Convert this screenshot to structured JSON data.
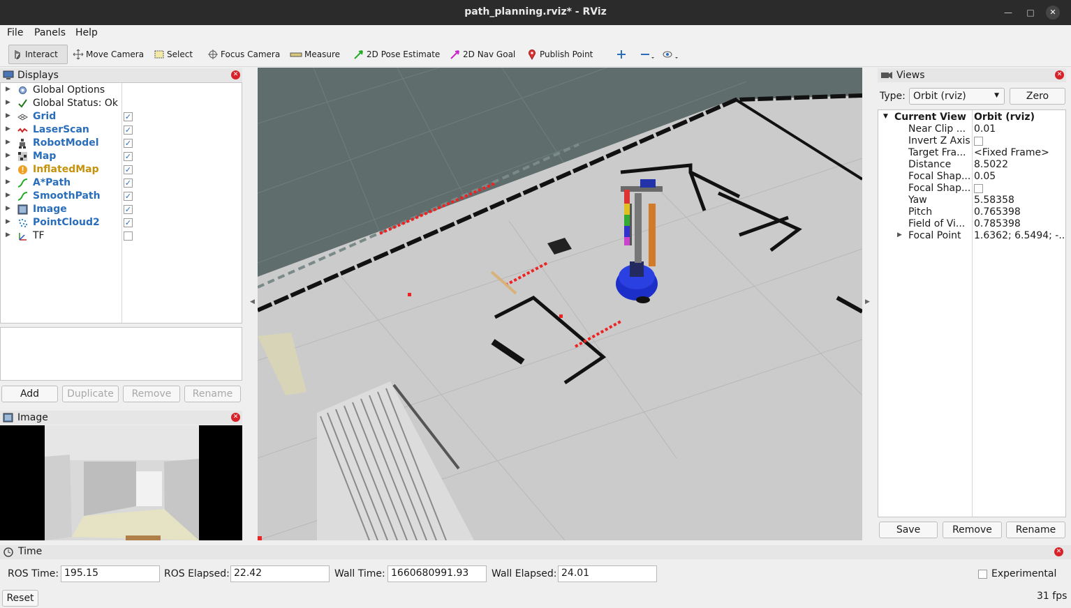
{
  "window": {
    "title": "path_planning.rviz* - RViz"
  },
  "menu": [
    "File",
    "Panels",
    "Help"
  ],
  "toolbar": {
    "interact": "Interact",
    "move_camera": "Move Camera",
    "select": "Select",
    "focus_camera": "Focus Camera",
    "measure": "Measure",
    "pose_estimate": "2D Pose Estimate",
    "nav_goal": "2D Nav Goal",
    "publish_point": "Publish Point"
  },
  "displays": {
    "title": "Displays",
    "items": [
      {
        "label": "Global Options",
        "icon": "gear-icon",
        "checked": null,
        "style": "plain"
      },
      {
        "label": "Global Status: Ok",
        "icon": "check-icon",
        "checked": null,
        "style": "plain"
      },
      {
        "label": "Grid",
        "icon": "grid-icon",
        "checked": true,
        "style": "blue"
      },
      {
        "label": "LaserScan",
        "icon": "laser-icon",
        "checked": true,
        "style": "blue"
      },
      {
        "label": "RobotModel",
        "icon": "robot-icon",
        "checked": true,
        "style": "blue"
      },
      {
        "label": "Map",
        "icon": "map-icon",
        "checked": true,
        "style": "blue"
      },
      {
        "label": "InflatedMap",
        "icon": "warning-icon",
        "checked": true,
        "style": "warn"
      },
      {
        "label": "A*Path",
        "icon": "path-icon",
        "checked": true,
        "style": "blue"
      },
      {
        "label": "SmoothPath",
        "icon": "path-icon",
        "checked": true,
        "style": "blue"
      },
      {
        "label": "Image",
        "icon": "image-icon",
        "checked": true,
        "style": "blue"
      },
      {
        "label": "PointCloud2",
        "icon": "pointcloud-icon",
        "checked": true,
        "style": "blue"
      },
      {
        "label": "TF",
        "icon": "tf-icon",
        "checked": false,
        "style": "plain"
      }
    ],
    "buttons": {
      "add": "Add",
      "duplicate": "Duplicate",
      "remove": "Remove",
      "rename": "Rename"
    }
  },
  "image_panel": {
    "title": "Image"
  },
  "views": {
    "title": "Views",
    "type_label": "Type:",
    "type_value": "Orbit (rviz)",
    "zero": "Zero",
    "current_view_label": "Current View",
    "current_view_value": "Orbit (rviz)",
    "props": [
      {
        "key": "Near Clip ...",
        "value": "0.01"
      },
      {
        "key": "Invert Z Axis",
        "value": "",
        "checkbox": true
      },
      {
        "key": "Target Fra...",
        "value": "<Fixed Frame>"
      },
      {
        "key": "Distance",
        "value": "8.5022"
      },
      {
        "key": "Focal Shap...",
        "value": "0.05"
      },
      {
        "key": "Focal Shap...",
        "value": "",
        "checkbox": true
      },
      {
        "key": "Yaw",
        "value": "5.58358"
      },
      {
        "key": "Pitch",
        "value": "0.765398"
      },
      {
        "key": "Field of Vi...",
        "value": "0.785398"
      },
      {
        "key": "Focal Point",
        "value": "1.6362; 6.5494; -...",
        "expandable": true
      }
    ],
    "buttons": {
      "save": "Save",
      "remove": "Remove",
      "rename": "Rename"
    }
  },
  "time": {
    "title": "Time",
    "ros_time_label": "ROS Time:",
    "ros_time": "195.15",
    "ros_elapsed_label": "ROS Elapsed:",
    "ros_elapsed": "22.42",
    "wall_time_label": "Wall Time:",
    "wall_time": "1660680991.93",
    "wall_elapsed_label": "Wall Elapsed:",
    "wall_elapsed": "24.01",
    "experimental": "Experimental",
    "reset": "Reset",
    "fps": "31 fps"
  }
}
